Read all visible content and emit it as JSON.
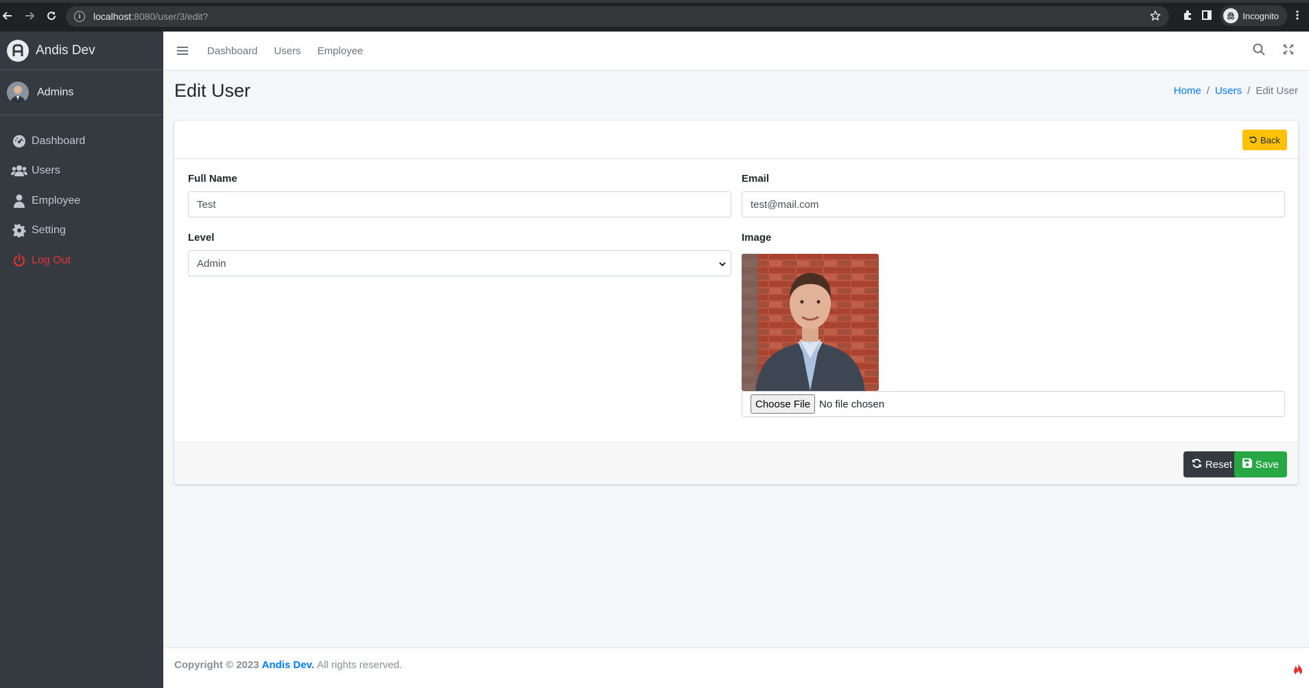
{
  "browser": {
    "url_host": "localhost",
    "url_path": ":8080/user/3/edit?",
    "profile_label": "Incognito"
  },
  "sidebar": {
    "brand": "Andis Dev",
    "user_name": "Admins",
    "items": [
      {
        "label": "Dashboard",
        "icon": "tachometer-icon"
      },
      {
        "label": "Users",
        "icon": "users-icon"
      },
      {
        "label": "Employee",
        "icon": "user-icon"
      },
      {
        "label": "Setting",
        "icon": "gear-icon"
      },
      {
        "label": "Log Out",
        "icon": "power-icon"
      }
    ]
  },
  "topnav": {
    "links": [
      "Dashboard",
      "Users",
      "Employee"
    ]
  },
  "page": {
    "title": "Edit User",
    "breadcrumb": [
      "Home",
      "Users",
      "Edit User"
    ],
    "separator": "/"
  },
  "form": {
    "back_label": "Back",
    "full_name_label": "Full Name",
    "full_name_value": "Test",
    "email_label": "Email",
    "email_value": "test@mail.com",
    "level_label": "Level",
    "level_value": "Admin",
    "image_label": "Image",
    "choose_file_label": "Choose File",
    "no_file_text": "No file chosen",
    "reset_label": "Reset",
    "save_label": "Save"
  },
  "footer": {
    "copyright": "Copyright © 2023",
    "company": "Andis Dev.",
    "rights": "All rights reserved."
  },
  "colors": {
    "sidebar_bg": "#343a40",
    "primary": "#007bff",
    "warning": "#ffc107",
    "success": "#28a745",
    "danger": "#e3342f"
  }
}
